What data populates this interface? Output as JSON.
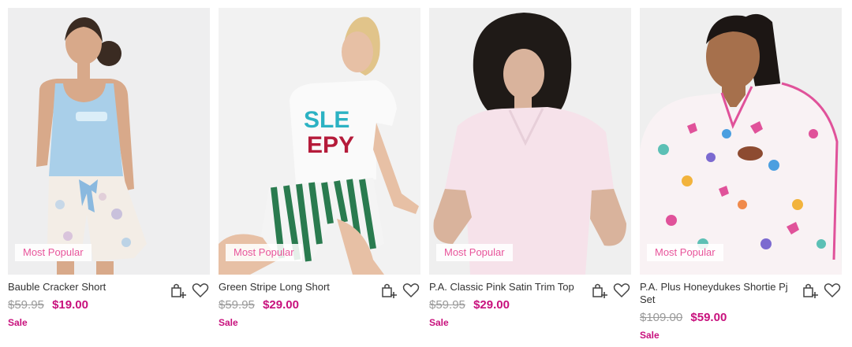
{
  "products": [
    {
      "name": "Bauble Cracker Short",
      "badge": "Most Popular",
      "was_price": "$59.95",
      "now_price": "$19.00",
      "sale_label": "Sale"
    },
    {
      "name": "Green Stripe Long Short",
      "badge": "Most Popular",
      "was_price": "$59.95",
      "now_price": "$29.00",
      "sale_label": "Sale",
      "shirt_text": [
        "SLE",
        "EPY"
      ]
    },
    {
      "name": "P.A. Classic Pink Satin Trim Top",
      "badge": "Most Popular",
      "was_price": "$59.95",
      "now_price": "$29.00",
      "sale_label": "Sale"
    },
    {
      "name": "P.A. Plus Honeydukes Shortie Pj Set",
      "badge": "Most Popular",
      "was_price": "$109.00",
      "now_price": "$59.00",
      "sale_label": "Sale"
    }
  ],
  "colors": {
    "badge_text": "#e8559b",
    "sale_price": "#c8117d",
    "was_price": "#9a9a9a"
  },
  "icons": [
    "add-to-bag-icon",
    "heart-icon"
  ]
}
